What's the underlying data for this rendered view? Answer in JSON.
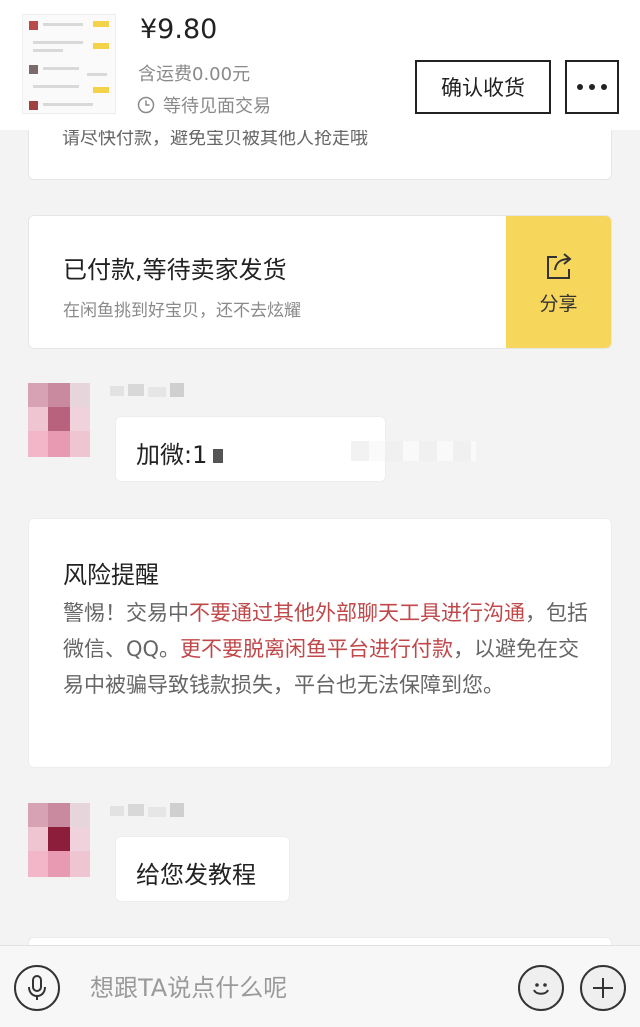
{
  "header": {
    "price": "¥9.80",
    "shipping": "含运费0.00元",
    "status": "等待见面交易",
    "confirm_label": "确认收货",
    "more_label": "•••"
  },
  "partial_notice": "请尽快付款，避免宝贝被其他人抢走哦",
  "paid_card": {
    "title": "已付款,等待卖家发货",
    "subtitle": "在闲鱼挑到好宝贝，还不去炫耀",
    "share_label": "分享"
  },
  "messages": [
    {
      "text": "加微:1"
    },
    {
      "text": "给您发教程"
    }
  ],
  "risk": {
    "title": "风险提醒",
    "seg1": "警惕！交易中",
    "seg2": "不要通过其他外部聊天工具进行沟通",
    "seg3": "，包括微信、QQ。",
    "seg4": "更不要脱离闲鱼平台进行付款",
    "seg5": "，以避免在交易中被骗导致钱款损失，平台也无法保障到您。"
  },
  "input": {
    "placeholder": "想跟TA说点什么呢"
  },
  "colors": {
    "accent_yellow": "#f7d65c",
    "warning_red": "#c0484a"
  }
}
